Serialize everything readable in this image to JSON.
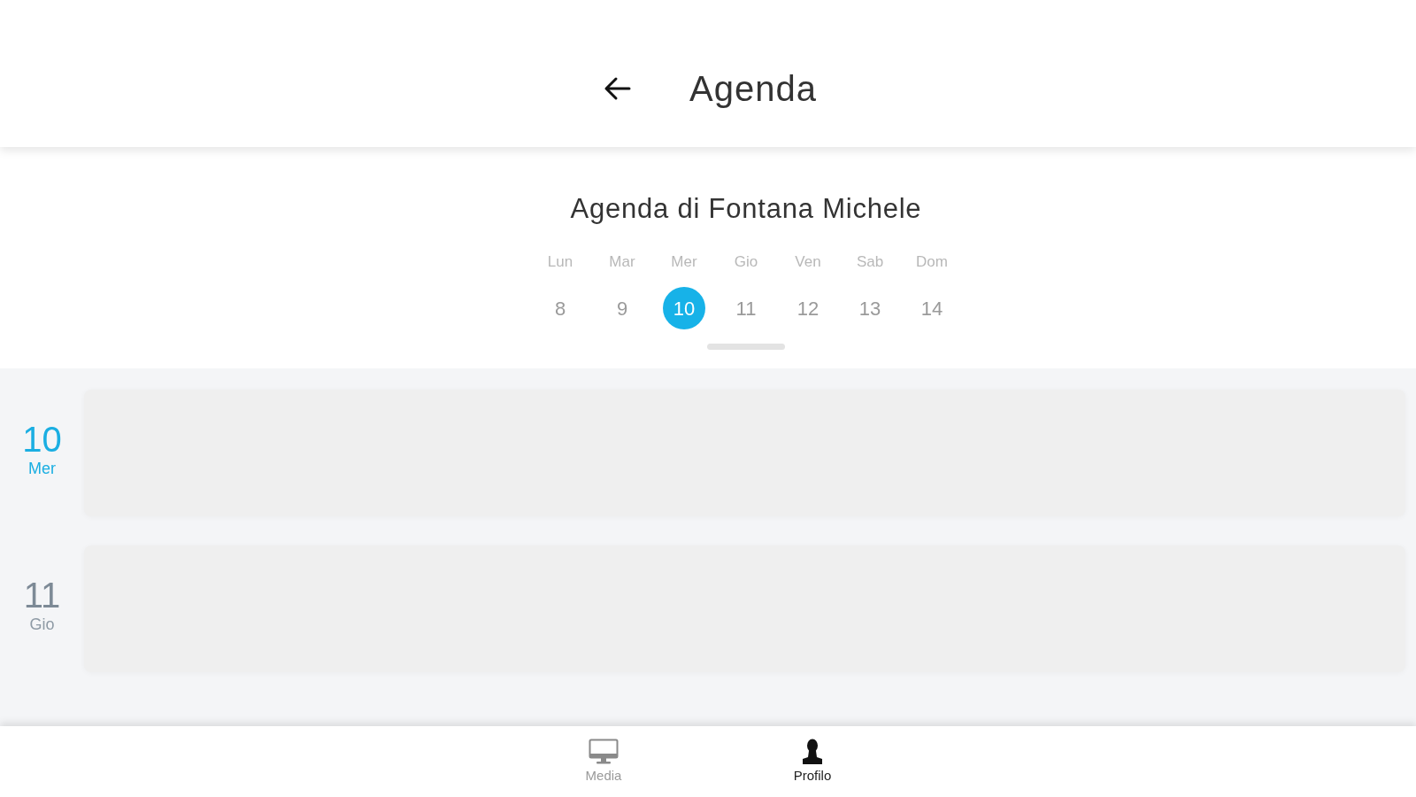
{
  "header": {
    "title": "Agenda"
  },
  "agenda": {
    "title": "Agenda di Fontana Michele",
    "days": [
      {
        "weekday": "Lun",
        "date": "8",
        "selected": false
      },
      {
        "weekday": "Mar",
        "date": "9",
        "selected": false
      },
      {
        "weekday": "Mer",
        "date": "10",
        "selected": true
      },
      {
        "weekday": "Gio",
        "date": "11",
        "selected": false
      },
      {
        "weekday": "Ven",
        "date": "12",
        "selected": false
      },
      {
        "weekday": "Sab",
        "date": "13",
        "selected": false
      },
      {
        "weekday": "Dom",
        "date": "14",
        "selected": false
      }
    ]
  },
  "day_rows": [
    {
      "date": "10",
      "weekday": "Mer",
      "current": true
    },
    {
      "date": "11",
      "weekday": "Gio",
      "current": false
    }
  ],
  "bottom_nav": [
    {
      "kind": "monitor",
      "label": "Media",
      "selected": false
    },
    {
      "kind": "person",
      "label": "Profilo",
      "selected": true
    }
  ]
}
